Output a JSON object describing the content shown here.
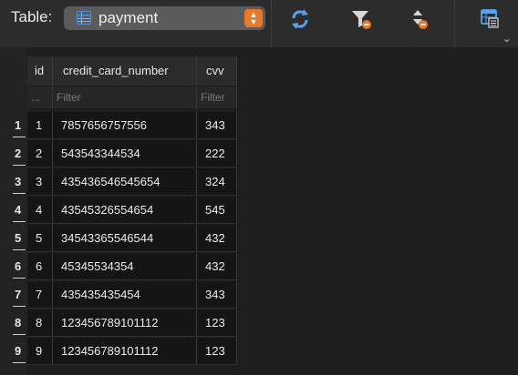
{
  "toolbar": {
    "table_label": "Table:",
    "table_name": "payment",
    "table_icon": "table-icon",
    "stepper_symbol": "⌃⌄",
    "tools": [
      {
        "name": "refresh-icon"
      },
      {
        "name": "filter-icon"
      },
      {
        "name": "sort-icon"
      },
      {
        "name": "table-info-icon"
      }
    ]
  },
  "grid": {
    "columns": [
      "id",
      "credit_card_number",
      "cvv"
    ],
    "filters": [
      "...",
      "Filter",
      "Filter"
    ],
    "rows": [
      {
        "num": "1",
        "id": "1",
        "credit_card_number": "7857656757556",
        "cvv": "343"
      },
      {
        "num": "2",
        "id": "2",
        "credit_card_number": "543543344534",
        "cvv": "222"
      },
      {
        "num": "3",
        "id": "3",
        "credit_card_number": "435436546545654",
        "cvv": "324"
      },
      {
        "num": "4",
        "id": "4",
        "credit_card_number": "43545326554654",
        "cvv": "545"
      },
      {
        "num": "5",
        "id": "5",
        "credit_card_number": "34543365546544",
        "cvv": "432"
      },
      {
        "num": "6",
        "id": "6",
        "credit_card_number": "45345534354",
        "cvv": "432"
      },
      {
        "num": "7",
        "id": "7",
        "credit_card_number": "435435435454",
        "cvv": "343"
      },
      {
        "num": "8",
        "id": "8",
        "credit_card_number": "123456789101112",
        "cvv": "123"
      },
      {
        "num": "9",
        "id": "9",
        "credit_card_number": "123456789101112",
        "cvv": "123"
      }
    ]
  },
  "colors": {
    "accent_orange": "#e8782a",
    "accent_blue": "#4a90e2"
  }
}
